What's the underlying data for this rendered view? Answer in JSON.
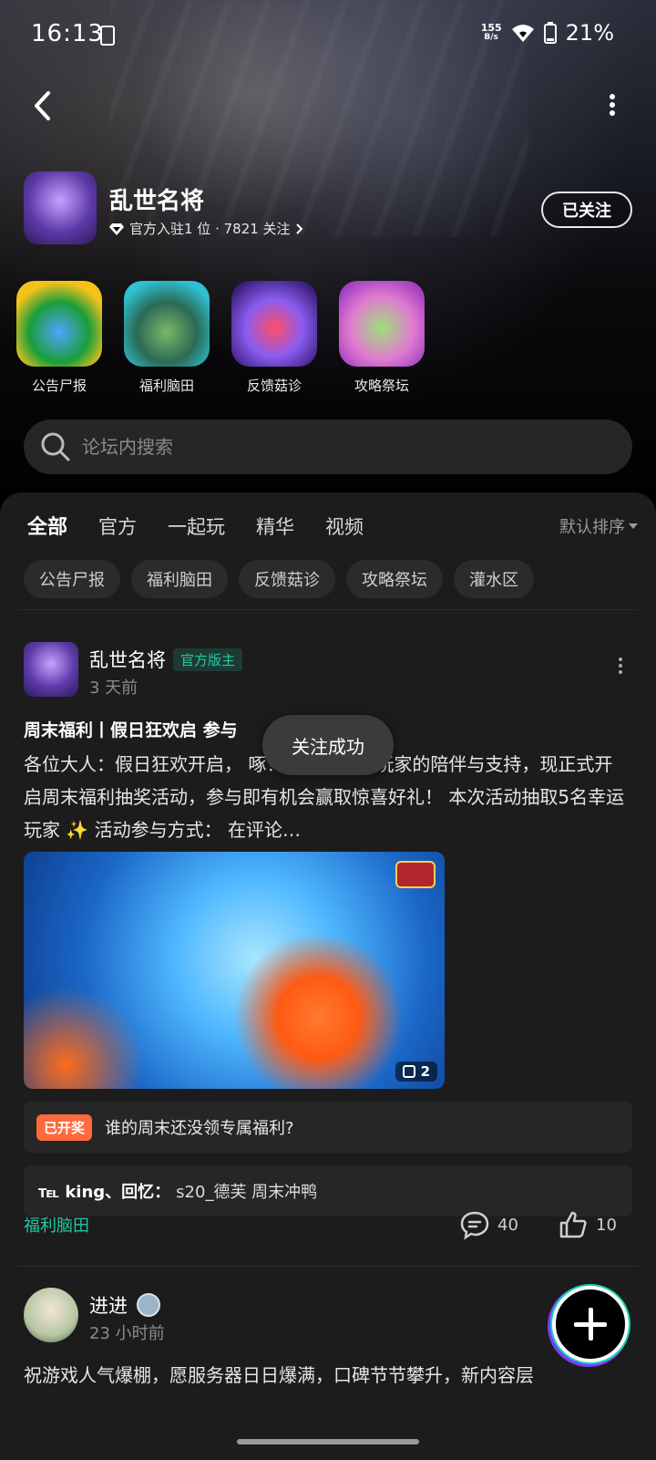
{
  "status_bar": {
    "time": "16:13",
    "net_speed_value": "155",
    "net_speed_unit": "B/s",
    "battery": "21%"
  },
  "forum": {
    "name": "乱世名将",
    "meta": "官方入驻1 位 · 7821 关注",
    "follow_label": "已关注"
  },
  "subforums": [
    {
      "label": "公告尸报",
      "color": "#f4c21b"
    },
    {
      "label": "福利脑田",
      "color": "#2ec1d3"
    },
    {
      "label": "反馈菇诊",
      "color": "#6e4bd6"
    },
    {
      "label": "攻略祭坛",
      "color": "#c54fd9"
    }
  ],
  "search": {
    "placeholder": "论坛内搜索"
  },
  "tabs": [
    "全部",
    "官方",
    "一起玩",
    "精华",
    "视频"
  ],
  "sort_label": "默认排序",
  "chips": [
    "公告尸报",
    "福利脑田",
    "反馈菇诊",
    "攻略祭坛",
    "灌水区"
  ],
  "post": {
    "author": "乱世名将",
    "badge": "官方版主",
    "time": "3 天前",
    "title": "周末福利丨假日狂欢启 参与",
    "body": "各位大人：假日狂欢开启，                  啄！为感谢各位玩家的陪伴与支持，现正式开启周末福利抽奖活动，参与即有机会赢取惊喜好礼！ 本次活动抽取5名幸运玩家 ✨ 活动参与方式： 在评论…",
    "image_count": "2",
    "lottery_badge": "已开奖",
    "lottery_text": "谁的周末还没领专属福利?",
    "reply_names": "℡ king、回忆：",
    "reply_text": "s20_德芙 周末冲鸭",
    "tag": "福利脑田",
    "comments": "40",
    "likes": "10"
  },
  "toast": "关注成功",
  "post2": {
    "author": "进进",
    "time": "23 小时前",
    "body": "祝游戏人气爆棚，愿服务器日日爆满，口碑节节攀升，新内容层"
  }
}
